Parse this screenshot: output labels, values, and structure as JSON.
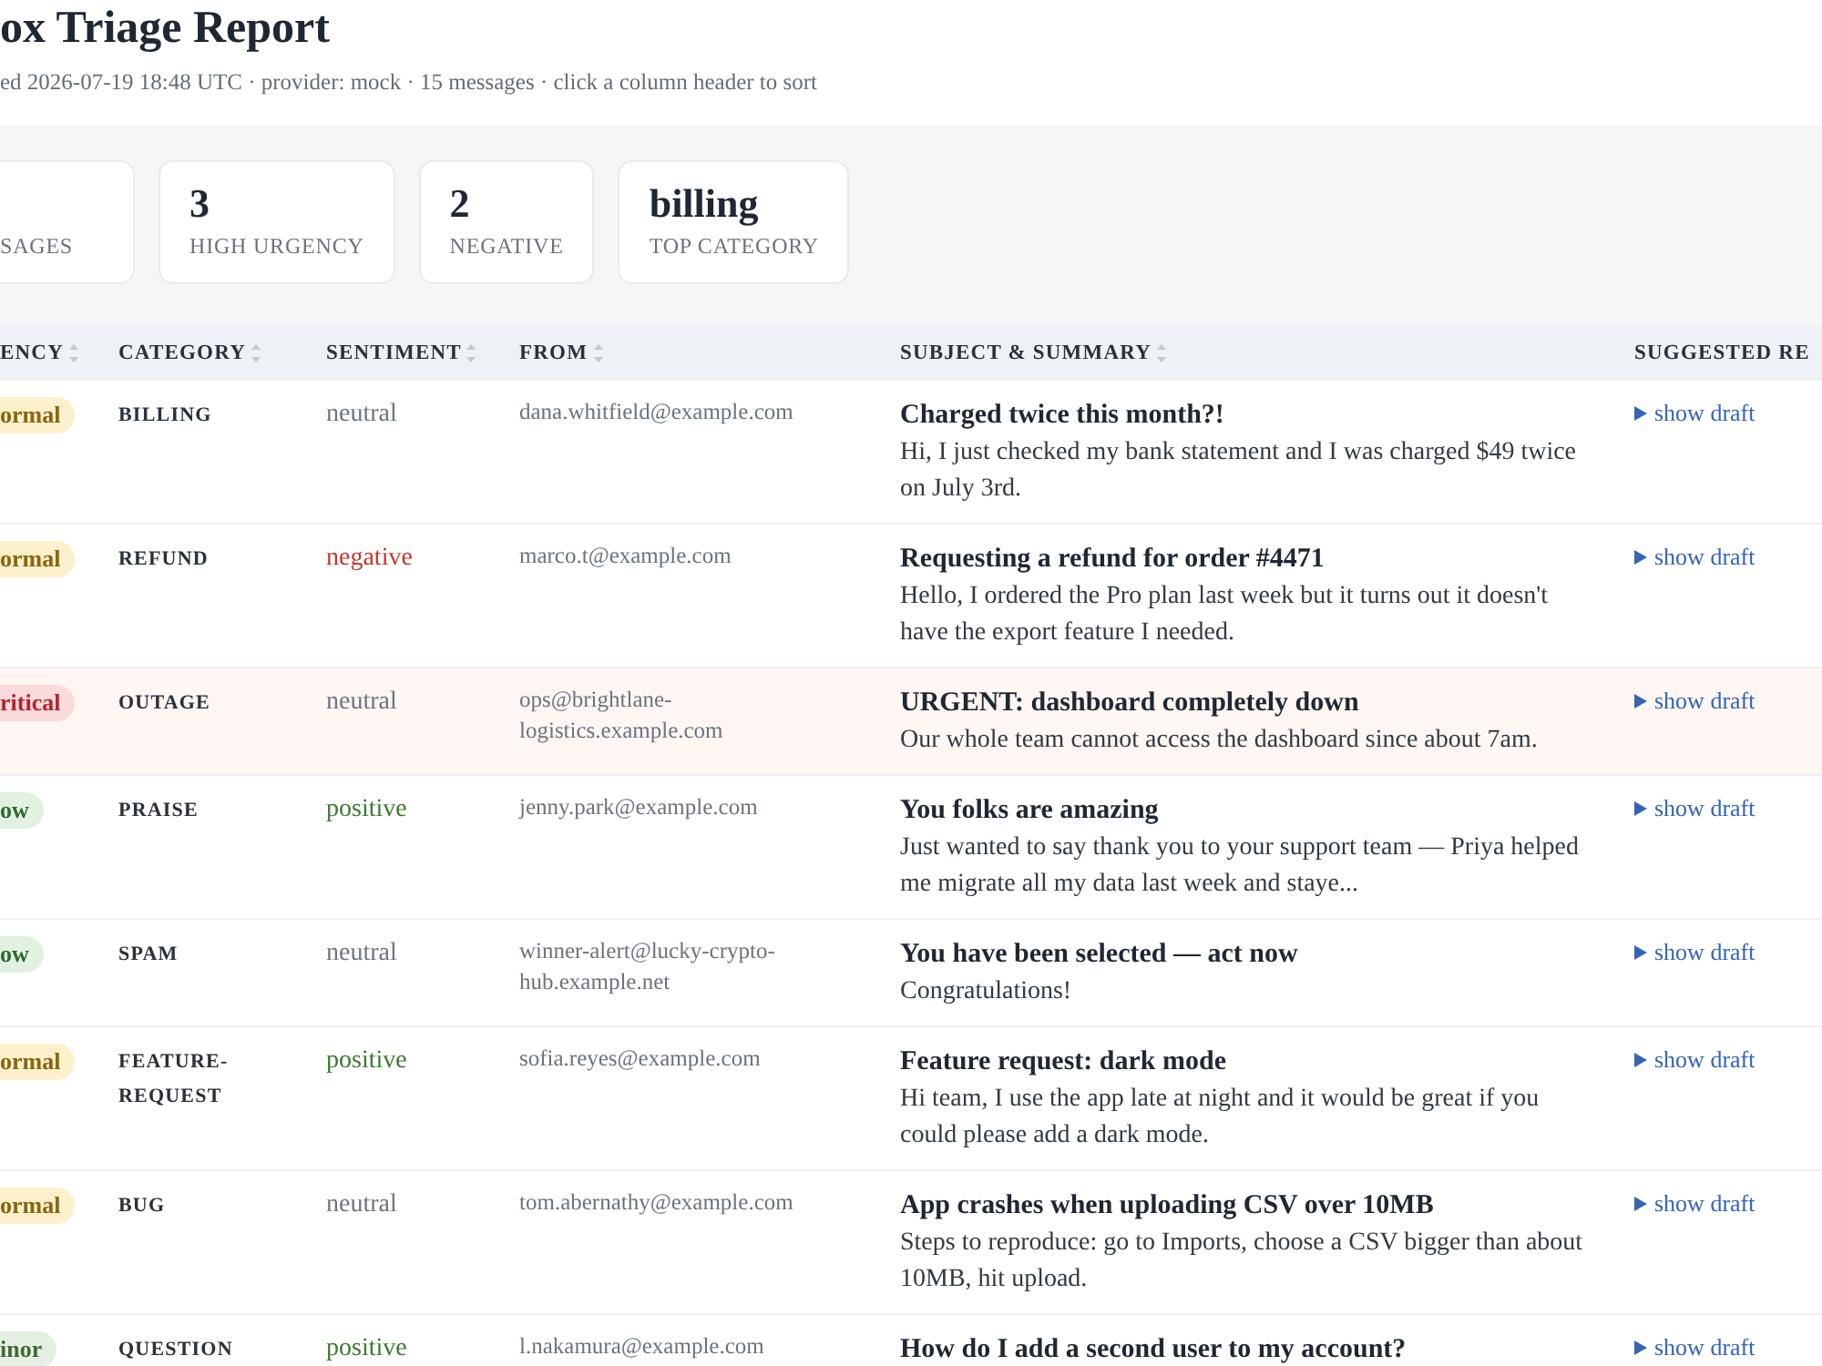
{
  "title": "ox Triage Report",
  "subtitle": "ed 2026-07-19 18:48 UTC · provider: mock · 15 messages · click a column header to sort",
  "stats": [
    {
      "label": "SAGES"
    },
    {
      "value": "3",
      "label": "HIGH URGENCY"
    },
    {
      "value": "2",
      "label": "NEGATIVE"
    },
    {
      "value": "billing",
      "label": "TOP CATEGORY"
    }
  ],
  "table": {
    "columns": [
      {
        "label": "ENCY",
        "sortable": true
      },
      {
        "label": "CATEGORY",
        "sortable": true
      },
      {
        "label": "SENTIMENT",
        "sortable": true
      },
      {
        "label": "FROM",
        "sortable": true
      },
      {
        "label": "SUBJECT & SUMMARY",
        "sortable": true
      },
      {
        "label": "SUGGESTED RE",
        "sortable": false
      }
    ],
    "rows": [
      {
        "urgency": {
          "text": "ormal",
          "kind": "normal"
        },
        "category": "BILLING",
        "sentiment": {
          "text": "neutral",
          "kind": "neutral"
        },
        "from": "dana.whitfield@example.com",
        "subject": "Charged twice this month?!",
        "summary": "Hi, I just checked my bank statement and I was charged $49 twice on July 3rd.",
        "reply": "show draft"
      },
      {
        "urgency": {
          "text": "ormal",
          "kind": "normal"
        },
        "category": "REFUND",
        "sentiment": {
          "text": "negative",
          "kind": "negative"
        },
        "from": "marco.t@example.com",
        "subject": "Requesting a refund for order #4471",
        "summary": "Hello, I ordered the Pro plan last week but it turns out it doesn't have the export feature I needed.",
        "reply": "show draft"
      },
      {
        "urgency": {
          "text": "ritical",
          "kind": "critical"
        },
        "category": "OUTAGE",
        "sentiment": {
          "text": "neutral",
          "kind": "neutral"
        },
        "from": "ops@brightlane-logistics.example.com",
        "subject": "URGENT: dashboard completely down",
        "summary": "Our whole team cannot access the dashboard since about 7am.",
        "reply": "show draft"
      },
      {
        "urgency": {
          "text": "ow",
          "kind": "low"
        },
        "category": "PRAISE",
        "sentiment": {
          "text": "positive",
          "kind": "positive"
        },
        "from": "jenny.park@example.com",
        "subject": "You folks are amazing",
        "summary": "Just wanted to say thank you to your support team — Priya helped me migrate all my data last week and staye...",
        "reply": "show draft"
      },
      {
        "urgency": {
          "text": "ow",
          "kind": "low"
        },
        "category": "SPAM",
        "sentiment": {
          "text": "neutral",
          "kind": "neutral"
        },
        "from": "winner-alert@lucky-crypto-hub.example.net",
        "subject": "You have been selected — act now",
        "summary": "Congratulations!",
        "reply": "show draft"
      },
      {
        "urgency": {
          "text": "ormal",
          "kind": "normal"
        },
        "category": "FEATURE-REQUEST",
        "sentiment": {
          "text": "positive",
          "kind": "positive"
        },
        "from": "sofia.reyes@example.com",
        "subject": "Feature request: dark mode",
        "summary": "Hi team, I use the app late at night and it would be great if you could please add a dark mode.",
        "reply": "show draft"
      },
      {
        "urgency": {
          "text": "ormal",
          "kind": "normal"
        },
        "category": "BUG",
        "sentiment": {
          "text": "neutral",
          "kind": "neutral"
        },
        "from": "tom.abernathy@example.com",
        "subject": "App crashes when uploading CSV over 10MB",
        "summary": "Steps to reproduce: go to Imports, choose a CSV bigger than about 10MB, hit upload.",
        "reply": "show draft"
      },
      {
        "urgency": {
          "text": "inor",
          "kind": "minor"
        },
        "category": "QUESTION",
        "sentiment": {
          "text": "positive",
          "kind": "positive"
        },
        "from": "l.nakamura@example.com",
        "subject": "How do I add a second user to my account?",
        "reply": "show draft"
      }
    ]
  }
}
